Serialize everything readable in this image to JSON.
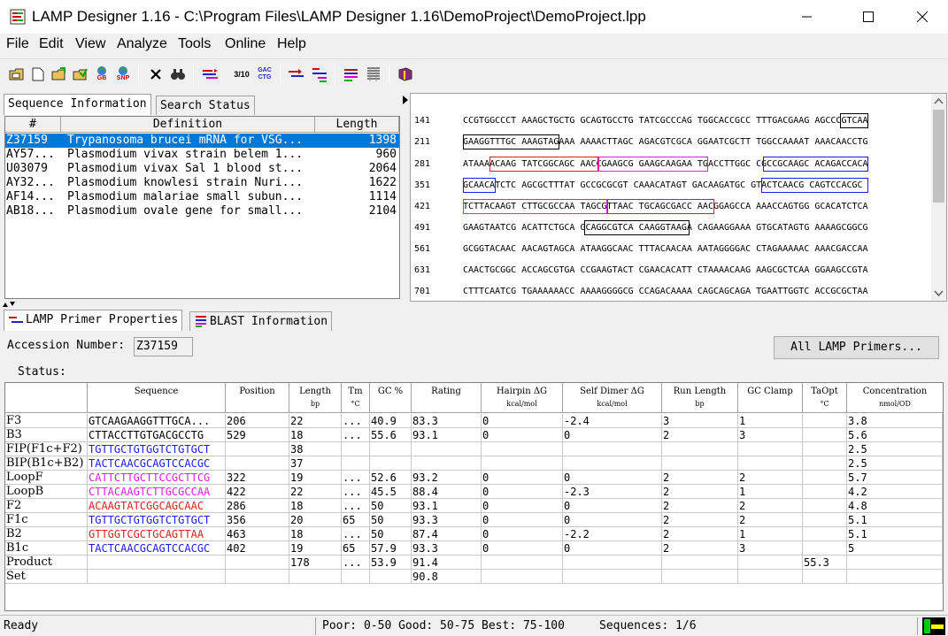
{
  "window": {
    "title": "LAMP Designer 1.16 - C:\\Program Files\\LAMP Designer 1.16\\DemoProject\\DemoProject.lpp"
  },
  "menu": [
    "File",
    "Edit",
    "View",
    "Analyze",
    "Tools",
    "Online",
    "Help"
  ],
  "toolbar_icons": [
    "open-folder-icon",
    "new-file-icon",
    "open-icon",
    "save-icon",
    "genbank-icon",
    "snp-icon",
    "delete-icon",
    "find-icon",
    "align-icon",
    "ratio-icon",
    "gac-ctg-icon",
    "primer-icon",
    "primer-map-icon",
    "report-icon",
    "blast-icon",
    "book-icon"
  ],
  "toolbar_text": {
    "gb": "GB",
    "snp": "SNP",
    "ratio": "3/10",
    "gac": "GAC",
    "ctg": "CTG"
  },
  "top_tabs": {
    "seq_info": "Sequence Information",
    "search_status": "Search Status"
  },
  "seq_table": {
    "headers": [
      "#",
      "Definition",
      "Length"
    ],
    "rows": [
      {
        "id": "Z37159",
        "def": "Trypanosoma brucei mRNA for VSG...",
        "len": "1398",
        "selected": true
      },
      {
        "id": "AY57...",
        "def": "Plasmodium vivax strain belem 1...",
        "len": "960"
      },
      {
        "id": "U03079",
        "def": "Plasmodium vivax Sal 1 blood st...",
        "len": "2064"
      },
      {
        "id": "AY32...",
        "def": "Plasmodium knowlesi strain Nuri...",
        "len": "1622"
      },
      {
        "id": "AF14...",
        "def": "Plasmodium malariae small subun...",
        "len": "1114"
      },
      {
        "id": "AB18...",
        "def": "Plasmodium ovale gene for small...",
        "len": "2104"
      }
    ]
  },
  "sequence_view": [
    {
      "num": "141",
      "seq": "CCGTGGCCCT AAAGCTGCTG GCAGTGCCTG TATCGCCCAG TGGCACCGCC TTTGACGAAG AGCCCGTCAA"
    },
    {
      "num": "211",
      "seq": "GAAGGTTTGC AAAGTAGAAA AAAACTTAGC AGACGTCGCA GGAATCGCTT TGGCCAAAAT AAACAACCTG"
    },
    {
      "num": "281",
      "seq": "ATAAAACAAG TATCGGCAGC AACCGAAGCG GAAGCAAGAA TGACCTTGGC CGCCGCAAGC ACAGACCACA"
    },
    {
      "num": "351",
      "seq": "GCAACATCTC AGCGCTTTAT GCCGCGCGT CAAACATAGT GACAAGATGC GTACTCAACG CAGTCCACGC"
    },
    {
      "num": "421",
      "seq": "TCTTACAAGT CTTGCGCCAA TAGCGTTAAC TGCAGCGACC AACGGAGCCA AAACCAGTGG GCACATCTCA"
    },
    {
      "num": "491",
      "seq": "GAAGTAATCG ACATTCTGCA GCAGGCGTCA CAAGGTAAGA CAGAAGGAAA GTGCATAGTG AAAAGCGGCG"
    },
    {
      "num": "561",
      "seq": "GCGGTACAAC AACAGTAGCA ATAAGGCAAC TTTACAACAA AATAGGGGAC CTAGAAAAAC AAACGACCAA"
    },
    {
      "num": "631",
      "seq": "CAACTGCGGC ACCAGCGTGA CCGAAGTACT CGAACACATT CTAAAACAAG AAGCGCTCAA GGAAGCCGTA"
    },
    {
      "num": "701",
      "seq": "CTTTCAATCG TGAAAAAACC AAAAGGGGCG CCAGACAAAA CAGCAGCAGA TGAATTGGTC ACCGCGCTAA"
    }
  ],
  "lower_tabs": {
    "props": "LAMP Primer Properties",
    "blast": "BLAST Information"
  },
  "accession": {
    "label": "Accession Number:",
    "value": "Z37159"
  },
  "all_primers_button": "All LAMP Primers...",
  "status_label": "Status:",
  "grid": {
    "headers": [
      {
        "t": "Sequence",
        "u": ""
      },
      {
        "t": "Position",
        "u": ""
      },
      {
        "t": "Length",
        "u": "bp"
      },
      {
        "t": "Tm",
        "u": "°C"
      },
      {
        "t": "GC %",
        "u": ""
      },
      {
        "t": "Rating",
        "u": ""
      },
      {
        "t": "Hairpin ΔG",
        "u": "kcal/mol"
      },
      {
        "t": "Self Dimer ΔG",
        "u": "kcal/mol"
      },
      {
        "t": "Run Length",
        "u": "bp"
      },
      {
        "t": "GC Clamp",
        "u": ""
      },
      {
        "t": "TaOpt",
        "u": "°C"
      },
      {
        "t": "Concentration",
        "u": "nmol/OD"
      }
    ],
    "rows": [
      {
        "name": "F3",
        "seq": "GTCAAGAAGGTTTGCA...",
        "color": "#000000",
        "pos": "206",
        "len": "22",
        "tm": "...",
        "gc": "40.9",
        "rating": "83.3",
        "hairpin": "0",
        "dimer": "-2.4",
        "run": "3",
        "clamp": "1",
        "ta": "",
        "conc": "3.8"
      },
      {
        "name": "B3",
        "seq": "CTTACCTTGTGACGCCTG",
        "color": "#000000",
        "pos": "529",
        "len": "18",
        "tm": "...",
        "gc": "55.6",
        "rating": "93.1",
        "hairpin": "0",
        "dimer": "0",
        "run": "2",
        "clamp": "3",
        "ta": "",
        "conc": "5.6"
      },
      {
        "name": "FIP(F1c+F2)",
        "seq": "TGTTGCTGTGGTCTGTGCT",
        "color": "#1a1aff",
        "pos": "",
        "len": "38",
        "tm": "",
        "gc": "",
        "rating": "",
        "hairpin": "",
        "dimer": "",
        "run": "",
        "clamp": "",
        "ta": "",
        "conc": "2.5"
      },
      {
        "name": "BIP(B1c+B2)",
        "seq": "TACTCAACGCAGTCCACGC",
        "color": "#1a1aff",
        "pos": "",
        "len": "37",
        "tm": "",
        "gc": "",
        "rating": "",
        "hairpin": "",
        "dimer": "",
        "run": "",
        "clamp": "",
        "ta": "",
        "conc": "2.5"
      },
      {
        "name": "LoopF",
        "seq": "CATTCTTGCTTCCGCTTCG",
        "color": "#e020e0",
        "pos": "322",
        "len": "19",
        "tm": "...",
        "gc": "52.6",
        "rating": "93.2",
        "hairpin": "0",
        "dimer": "0",
        "run": "2",
        "clamp": "2",
        "ta": "",
        "conc": "5.7"
      },
      {
        "name": "LoopB",
        "seq": "CTTACAAGTCTTGCGCCAA",
        "color": "#e020e0",
        "pos": "422",
        "len": "22",
        "tm": "...",
        "gc": "45.5",
        "rating": "88.4",
        "hairpin": "0",
        "dimer": "-2.3",
        "run": "2",
        "clamp": "1",
        "ta": "",
        "conc": "4.2"
      },
      {
        "name": "F2",
        "seq": "ACAAGTATCGGCAGCAAC",
        "color": "#e02020",
        "pos": "286",
        "len": "18",
        "tm": "...",
        "gc": "50",
        "rating": "93.1",
        "hairpin": "0",
        "dimer": "0",
        "run": "2",
        "clamp": "2",
        "ta": "",
        "conc": "4.8"
      },
      {
        "name": "F1c",
        "seq": "TGTTGCTGTGGTCTGTGCT",
        "color": "#1a1aff",
        "pos": "356",
        "len": "20",
        "tm": "65",
        "gc": "50",
        "rating": "93.3",
        "hairpin": "0",
        "dimer": "0",
        "run": "2",
        "clamp": "2",
        "ta": "",
        "conc": "5.1"
      },
      {
        "name": "B2",
        "seq": "GTTGGTCGCTGCAGTTAA",
        "color": "#e02020",
        "pos": "463",
        "len": "18",
        "tm": "...",
        "gc": "50",
        "rating": "87.4",
        "hairpin": "0",
        "dimer": "-2.2",
        "run": "2",
        "clamp": "1",
        "ta": "",
        "conc": "5.1"
      },
      {
        "name": "B1c",
        "seq": "TACTCAACGCAGTCCACGC",
        "color": "#1a1aff",
        "pos": "402",
        "len": "19",
        "tm": "65",
        "gc": "57.9",
        "rating": "93.3",
        "hairpin": "0",
        "dimer": "0",
        "run": "2",
        "clamp": "3",
        "ta": "",
        "conc": "5"
      },
      {
        "name": "Product",
        "seq": "",
        "color": "#000000",
        "pos": "",
        "len": "178",
        "tm": "...",
        "gc": "53.9",
        "rating": "91.4",
        "hairpin": "",
        "dimer": "",
        "run": "",
        "clamp": "",
        "ta": "55.3",
        "conc": ""
      },
      {
        "name": "Set",
        "seq": "",
        "color": "#000000",
        "pos": "",
        "len": "",
        "tm": "",
        "gc": "",
        "rating": "90.8",
        "hairpin": "",
        "dimer": "",
        "run": "",
        "clamp": "",
        "ta": "",
        "conc": ""
      }
    ]
  },
  "statusbar": {
    "ready": "Ready",
    "legend": "Poor: 0-50 Good: 50-75 Best: 75-100",
    "sequences": "Sequences: 1/6"
  }
}
